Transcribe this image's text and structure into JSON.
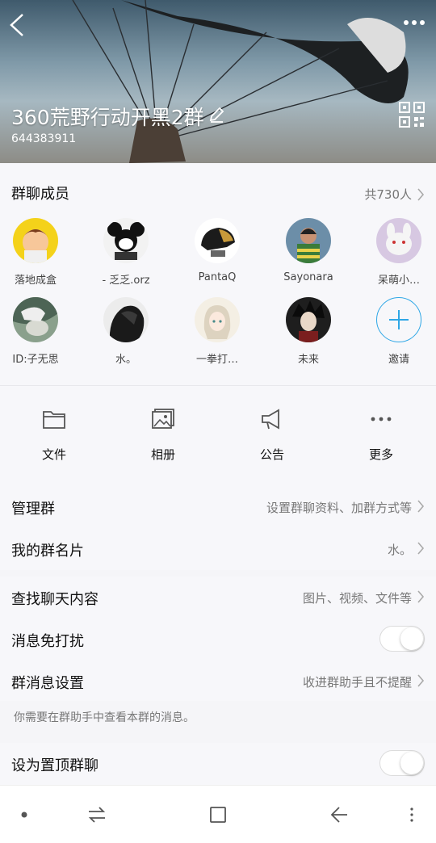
{
  "header": {
    "title": "360荒野行动开黑2群",
    "group_id": "644383911"
  },
  "members": {
    "title": "群聊成员",
    "count": "共730人",
    "list": [
      {
        "name": "落地成盒"
      },
      {
        "name": "- 乏乏.orz"
      },
      {
        "name": "PantaQ"
      },
      {
        "name": "Sayonara"
      },
      {
        "name": "呆萌小…"
      },
      {
        "name": "ID:子无思"
      },
      {
        "name": "水。"
      },
      {
        "name": "一拳打…"
      },
      {
        "name": "未来"
      }
    ],
    "invite_label": "邀请"
  },
  "actions": [
    {
      "label": "文件",
      "icon": "folder-icon"
    },
    {
      "label": "相册",
      "icon": "album-icon"
    },
    {
      "label": "公告",
      "icon": "megaphone-icon"
    },
    {
      "label": "更多",
      "icon": "more-icon"
    }
  ],
  "settings": {
    "manage": {
      "label": "管理群",
      "value": "设置群聊资料、加群方式等"
    },
    "card": {
      "label": "我的群名片",
      "value": "水。"
    },
    "search": {
      "label": "查找聊天内容",
      "value": "图片、视频、文件等"
    },
    "dnd": {
      "label": "消息免打扰",
      "on": false
    },
    "msg": {
      "label": "群消息设置",
      "value": "收进群助手且不提醒"
    },
    "hint": "你需要在群助手中查看本群的消息。",
    "pin": {
      "label": "设为置顶群聊",
      "on": false
    }
  },
  "colors": {
    "accent": "#2fa7e6",
    "text": "#111111",
    "muted": "#777777",
    "background": "#f7f7fa"
  }
}
